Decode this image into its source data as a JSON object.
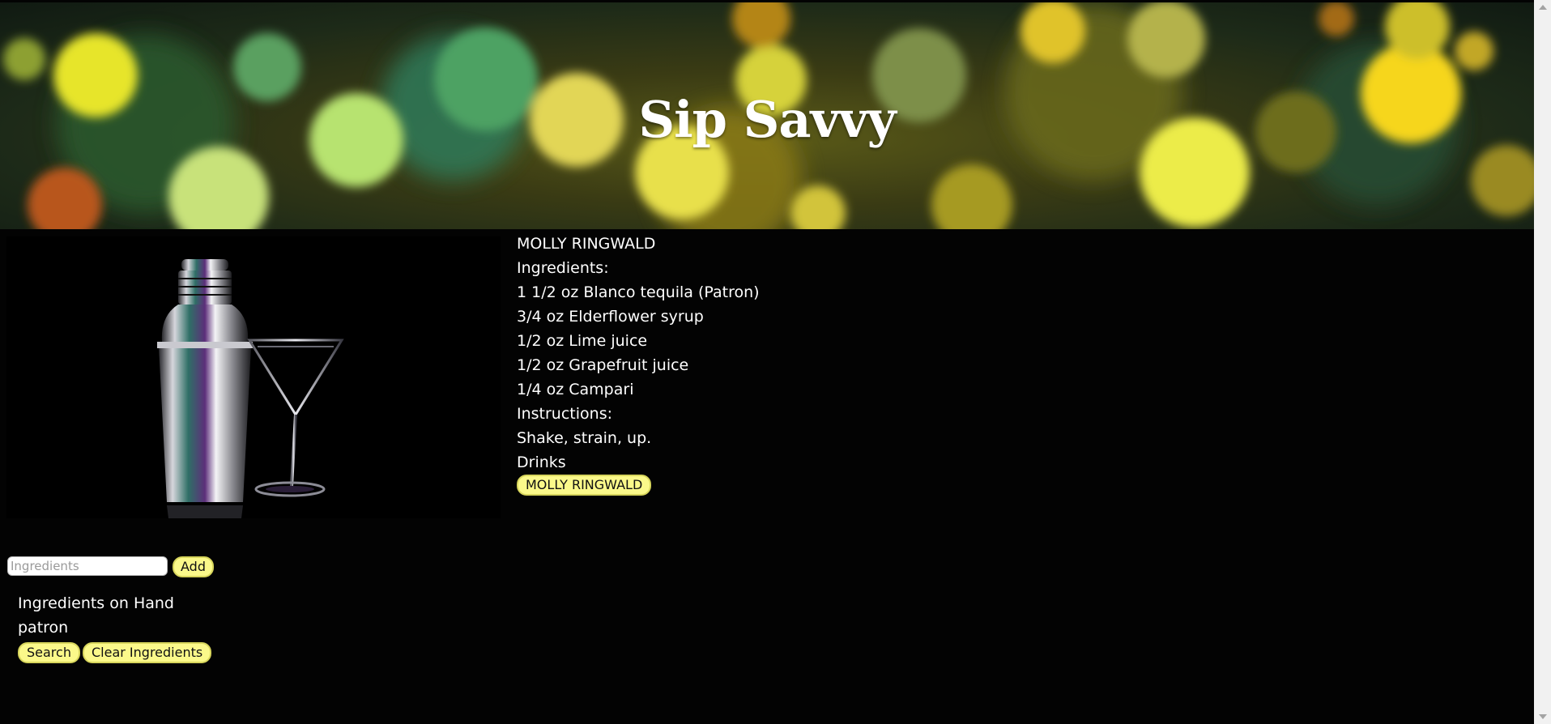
{
  "header": {
    "title": "Sip Savvy"
  },
  "recipe": {
    "name": "MOLLY RINGWALD",
    "ingredients_label": "Ingredients:",
    "ingredients": [
      "1 1/2 oz Blanco tequila (Patron)",
      "3/4 oz Elderflower syrup",
      "1/2 oz Lime juice",
      "1/2 oz Grapefruit juice",
      "1/4 oz Campari"
    ],
    "instructions_label": "Instructions:",
    "instructions": "Shake, strain, up.",
    "drinks_label": "Drinks",
    "drink_results": [
      "MOLLY RINGWALD"
    ]
  },
  "form": {
    "ingredient_placeholder": "Ingredients",
    "add_label": "Add"
  },
  "on_hand": {
    "title": "Ingredients on Hand",
    "items": [
      "patron"
    ],
    "search_label": "Search",
    "clear_label": "Clear Ingredients"
  },
  "colors": {
    "background": "#030303",
    "button_fill": "#fbf98a",
    "text": "#ffffff"
  }
}
